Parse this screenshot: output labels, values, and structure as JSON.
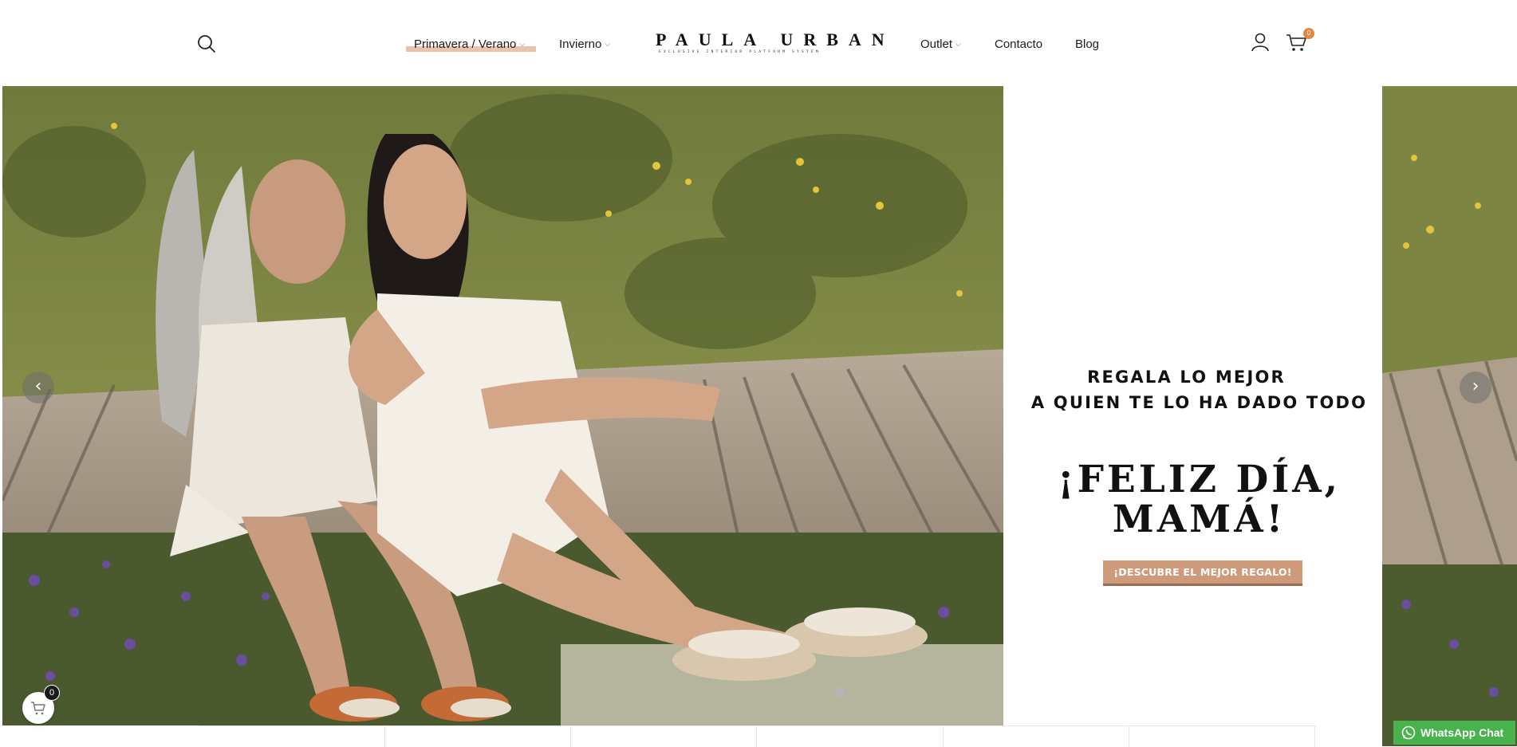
{
  "header": {
    "nav": [
      {
        "label": "Primavera / Verano",
        "has_dropdown": true,
        "active": true
      },
      {
        "label": "Invierno",
        "has_dropdown": true
      },
      {
        "label": "Outlet",
        "has_dropdown": true
      },
      {
        "label": "Contacto"
      },
      {
        "label": "Blog"
      }
    ],
    "logo": {
      "text": "PAULA URBAN",
      "tagline": "EXCLUSIVE INTERIOR PLATFORM SYSTEM"
    },
    "cart_count": "0",
    "icons": [
      "search-icon",
      "user-icon",
      "cart-icon"
    ]
  },
  "hero": {
    "subtitle_line1": "REGALA LO MEJOR",
    "subtitle_line2": "A QUIEN TE LO HA DADO TODO",
    "headline_line1": "¡FELIZ DÍA,",
    "headline_line2": "MAMÁ!",
    "cta_label": "¡DESCUBRE EL MEJOR REGALO!",
    "prev_arrow": "‹",
    "next_arrow": "›"
  },
  "floating_cart": {
    "count": "0"
  },
  "whatsapp": {
    "label": "WhatsApp Chat"
  },
  "colors": {
    "accent": "#cf9a79",
    "nav_highlight": "#eac3ac",
    "cart_badge": "#e6873f",
    "whatsapp": "#48b34d"
  }
}
